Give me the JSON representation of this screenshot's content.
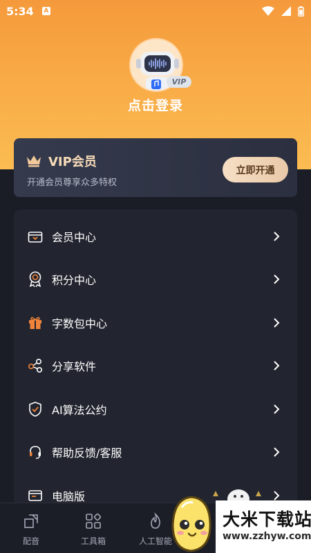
{
  "status_bar": {
    "time": "5:34",
    "notification_badge": "A",
    "icons": [
      "wifi-icon",
      "signal-icon",
      "battery-icon"
    ]
  },
  "profile": {
    "vip_tag": "VIP",
    "login_label": "点击登录"
  },
  "vip_card": {
    "title": "VIP会员",
    "subtitle": "开通会员尊享众多特权",
    "button_label": "立即开通"
  },
  "menu": {
    "items": [
      {
        "label": "会员中心",
        "icon": "member-icon"
      },
      {
        "label": "积分中心",
        "icon": "medal-icon"
      },
      {
        "label": "字数包中心",
        "icon": "gift-icon"
      },
      {
        "label": "分享软件",
        "icon": "share-icon"
      },
      {
        "label": "AI算法公约",
        "icon": "shield-check-icon"
      },
      {
        "label": "帮助反馈/客服",
        "icon": "headset-icon"
      },
      {
        "label": "电脑版",
        "icon": "desktop-icon"
      }
    ]
  },
  "tab_bar": {
    "tabs": [
      {
        "label": "配音",
        "icon": "dubbing-icon"
      },
      {
        "label": "工具箱",
        "icon": "toolbox-icon"
      },
      {
        "label": "人工智能",
        "icon": "flame-icon"
      }
    ]
  },
  "watermark": {
    "title": "大米下载站",
    "url": "www.zzhyw.com"
  },
  "colors": {
    "header_orange": "#f59a3c",
    "background": "#1a1c26",
    "card": "#22252f",
    "vip_gold": "#f8dcb8",
    "icon_orange": "#f0843a"
  }
}
